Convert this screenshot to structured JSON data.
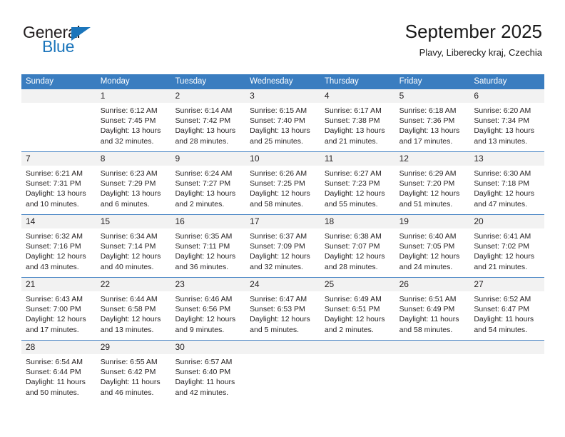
{
  "brand": {
    "name_top": "General",
    "name_bottom": "Blue",
    "accent_color": "#1b75bb"
  },
  "header": {
    "title": "September 2025",
    "subtitle": "Plavy, Liberecky kraj, Czechia"
  },
  "calendar": {
    "header_color": "#3a7dc0",
    "day_strip_color": "#f2f2f2",
    "weekdays": [
      "Sunday",
      "Monday",
      "Tuesday",
      "Wednesday",
      "Thursday",
      "Friday",
      "Saturday"
    ],
    "weeks": [
      [
        {
          "day": "",
          "lines": []
        },
        {
          "day": "1",
          "lines": [
            "Sunrise: 6:12 AM",
            "Sunset: 7:45 PM",
            "Daylight: 13 hours",
            "and 32 minutes."
          ]
        },
        {
          "day": "2",
          "lines": [
            "Sunrise: 6:14 AM",
            "Sunset: 7:42 PM",
            "Daylight: 13 hours",
            "and 28 minutes."
          ]
        },
        {
          "day": "3",
          "lines": [
            "Sunrise: 6:15 AM",
            "Sunset: 7:40 PM",
            "Daylight: 13 hours",
            "and 25 minutes."
          ]
        },
        {
          "day": "4",
          "lines": [
            "Sunrise: 6:17 AM",
            "Sunset: 7:38 PM",
            "Daylight: 13 hours",
            "and 21 minutes."
          ]
        },
        {
          "day": "5",
          "lines": [
            "Sunrise: 6:18 AM",
            "Sunset: 7:36 PM",
            "Daylight: 13 hours",
            "and 17 minutes."
          ]
        },
        {
          "day": "6",
          "lines": [
            "Sunrise: 6:20 AM",
            "Sunset: 7:34 PM",
            "Daylight: 13 hours",
            "and 13 minutes."
          ]
        }
      ],
      [
        {
          "day": "7",
          "lines": [
            "Sunrise: 6:21 AM",
            "Sunset: 7:31 PM",
            "Daylight: 13 hours",
            "and 10 minutes."
          ]
        },
        {
          "day": "8",
          "lines": [
            "Sunrise: 6:23 AM",
            "Sunset: 7:29 PM",
            "Daylight: 13 hours",
            "and 6 minutes."
          ]
        },
        {
          "day": "9",
          "lines": [
            "Sunrise: 6:24 AM",
            "Sunset: 7:27 PM",
            "Daylight: 13 hours",
            "and 2 minutes."
          ]
        },
        {
          "day": "10",
          "lines": [
            "Sunrise: 6:26 AM",
            "Sunset: 7:25 PM",
            "Daylight: 12 hours",
            "and 58 minutes."
          ]
        },
        {
          "day": "11",
          "lines": [
            "Sunrise: 6:27 AM",
            "Sunset: 7:23 PM",
            "Daylight: 12 hours",
            "and 55 minutes."
          ]
        },
        {
          "day": "12",
          "lines": [
            "Sunrise: 6:29 AM",
            "Sunset: 7:20 PM",
            "Daylight: 12 hours",
            "and 51 minutes."
          ]
        },
        {
          "day": "13",
          "lines": [
            "Sunrise: 6:30 AM",
            "Sunset: 7:18 PM",
            "Daylight: 12 hours",
            "and 47 minutes."
          ]
        }
      ],
      [
        {
          "day": "14",
          "lines": [
            "Sunrise: 6:32 AM",
            "Sunset: 7:16 PM",
            "Daylight: 12 hours",
            "and 43 minutes."
          ]
        },
        {
          "day": "15",
          "lines": [
            "Sunrise: 6:34 AM",
            "Sunset: 7:14 PM",
            "Daylight: 12 hours",
            "and 40 minutes."
          ]
        },
        {
          "day": "16",
          "lines": [
            "Sunrise: 6:35 AM",
            "Sunset: 7:11 PM",
            "Daylight: 12 hours",
            "and 36 minutes."
          ]
        },
        {
          "day": "17",
          "lines": [
            "Sunrise: 6:37 AM",
            "Sunset: 7:09 PM",
            "Daylight: 12 hours",
            "and 32 minutes."
          ]
        },
        {
          "day": "18",
          "lines": [
            "Sunrise: 6:38 AM",
            "Sunset: 7:07 PM",
            "Daylight: 12 hours",
            "and 28 minutes."
          ]
        },
        {
          "day": "19",
          "lines": [
            "Sunrise: 6:40 AM",
            "Sunset: 7:05 PM",
            "Daylight: 12 hours",
            "and 24 minutes."
          ]
        },
        {
          "day": "20",
          "lines": [
            "Sunrise: 6:41 AM",
            "Sunset: 7:02 PM",
            "Daylight: 12 hours",
            "and 21 minutes."
          ]
        }
      ],
      [
        {
          "day": "21",
          "lines": [
            "Sunrise: 6:43 AM",
            "Sunset: 7:00 PM",
            "Daylight: 12 hours",
            "and 17 minutes."
          ]
        },
        {
          "day": "22",
          "lines": [
            "Sunrise: 6:44 AM",
            "Sunset: 6:58 PM",
            "Daylight: 12 hours",
            "and 13 minutes."
          ]
        },
        {
          "day": "23",
          "lines": [
            "Sunrise: 6:46 AM",
            "Sunset: 6:56 PM",
            "Daylight: 12 hours",
            "and 9 minutes."
          ]
        },
        {
          "day": "24",
          "lines": [
            "Sunrise: 6:47 AM",
            "Sunset: 6:53 PM",
            "Daylight: 12 hours",
            "and 5 minutes."
          ]
        },
        {
          "day": "25",
          "lines": [
            "Sunrise: 6:49 AM",
            "Sunset: 6:51 PM",
            "Daylight: 12 hours",
            "and 2 minutes."
          ]
        },
        {
          "day": "26",
          "lines": [
            "Sunrise: 6:51 AM",
            "Sunset: 6:49 PM",
            "Daylight: 11 hours",
            "and 58 minutes."
          ]
        },
        {
          "day": "27",
          "lines": [
            "Sunrise: 6:52 AM",
            "Sunset: 6:47 PM",
            "Daylight: 11 hours",
            "and 54 minutes."
          ]
        }
      ],
      [
        {
          "day": "28",
          "lines": [
            "Sunrise: 6:54 AM",
            "Sunset: 6:44 PM",
            "Daylight: 11 hours",
            "and 50 minutes."
          ]
        },
        {
          "day": "29",
          "lines": [
            "Sunrise: 6:55 AM",
            "Sunset: 6:42 PM",
            "Daylight: 11 hours",
            "and 46 minutes."
          ]
        },
        {
          "day": "30",
          "lines": [
            "Sunrise: 6:57 AM",
            "Sunset: 6:40 PM",
            "Daylight: 11 hours",
            "and 42 minutes."
          ]
        },
        {
          "day": "",
          "lines": []
        },
        {
          "day": "",
          "lines": []
        },
        {
          "day": "",
          "lines": []
        },
        {
          "day": "",
          "lines": []
        }
      ]
    ]
  }
}
